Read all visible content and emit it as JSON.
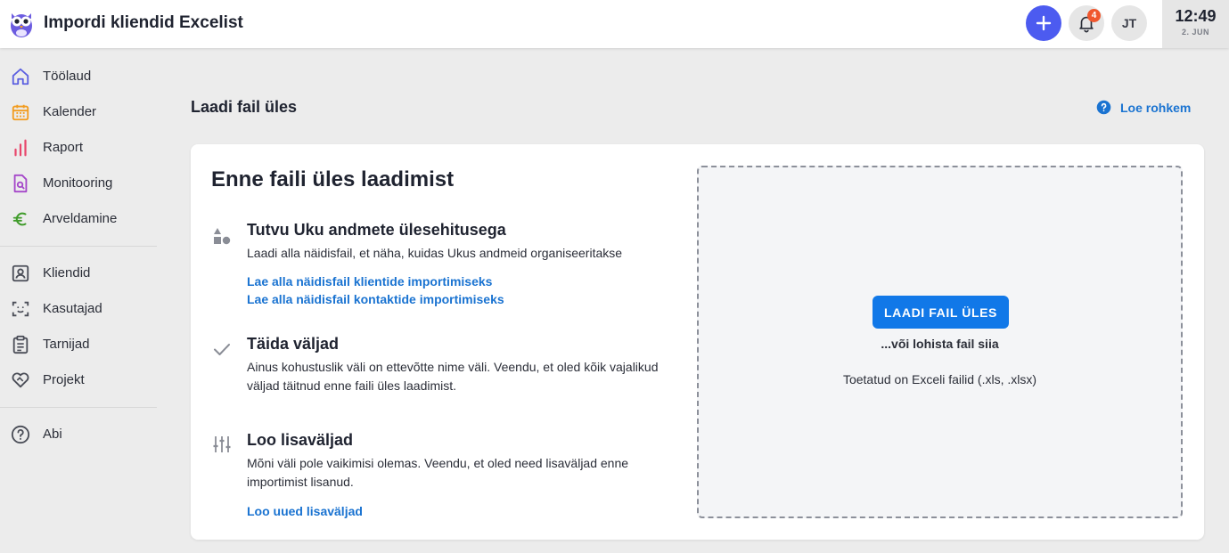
{
  "header": {
    "title": "Impordi kliendid Excelist",
    "logo_icon": "owl-logo",
    "notification_count": "4",
    "avatar_initials": "JT",
    "clock": {
      "time": "12:49",
      "date": "2. JUN"
    },
    "accent_color": "#4c5bf0"
  },
  "sidebar": {
    "items": [
      {
        "label": "Töölaud",
        "icon": "home-icon",
        "color": "#5b5fe0"
      },
      {
        "label": "Kalender",
        "icon": "calendar-icon",
        "color": "#f29c1f"
      },
      {
        "label": "Raport",
        "icon": "bar-chart-icon",
        "color": "#e8466b"
      },
      {
        "label": "Monitooring",
        "icon": "document-search-icon",
        "color": "#a547c9"
      },
      {
        "label": "Arveldamine",
        "icon": "euro-icon",
        "color": "#3f9b2a"
      },
      {
        "label": "Kliendid",
        "icon": "client-card-icon",
        "color": "#4a4d57"
      },
      {
        "label": "Kasutajad",
        "icon": "face-scan-icon",
        "color": "#4a4d57"
      },
      {
        "label": "Tarnijad",
        "icon": "clipboard-list-icon",
        "color": "#4a4d57"
      },
      {
        "label": "Projekt",
        "icon": "handshake-heart-icon",
        "color": "#4a4d57"
      },
      {
        "label": "Abi",
        "icon": "help-circle-icon",
        "color": "#4a4d57"
      }
    ]
  },
  "main": {
    "heading": "Laadi fail üles",
    "help_link": "Loe rohkem",
    "card": {
      "title": "Enne faili üles laadimist",
      "steps": [
        {
          "icon": "shapes-icon",
          "title": "Tutvu Uku andmete ülesehitusega",
          "description": "Laadi alla näidisfail, et näha, kuidas Ukus andmeid organiseeritakse",
          "links": [
            "Lae alla näidisfail klientide importimiseks",
            "Lae alla näidisfail kontaktide importimiseks"
          ]
        },
        {
          "icon": "check-icon",
          "title": "Täida väljad",
          "description": "Ainus kohustuslik väli on ettevõtte nime väli. Veendu, et oled kõik vajalikud väljad täitnud enne faili üles laadimist.",
          "links": []
        },
        {
          "icon": "sliders-icon",
          "title": "Loo lisaväljad",
          "description": "Mõni väli pole vaikimisi olemas. Veendu, et oled need lisaväljad enne importimist lisanud.",
          "links": [
            "Loo uued lisaväljad"
          ]
        }
      ],
      "dropzone": {
        "button_label": "LAADI FAIL ÜLES",
        "drag_text": "...või lohista fail siia",
        "supported_text": "Toetatud on Exceli failid (.xls, .xlsx)"
      }
    }
  }
}
